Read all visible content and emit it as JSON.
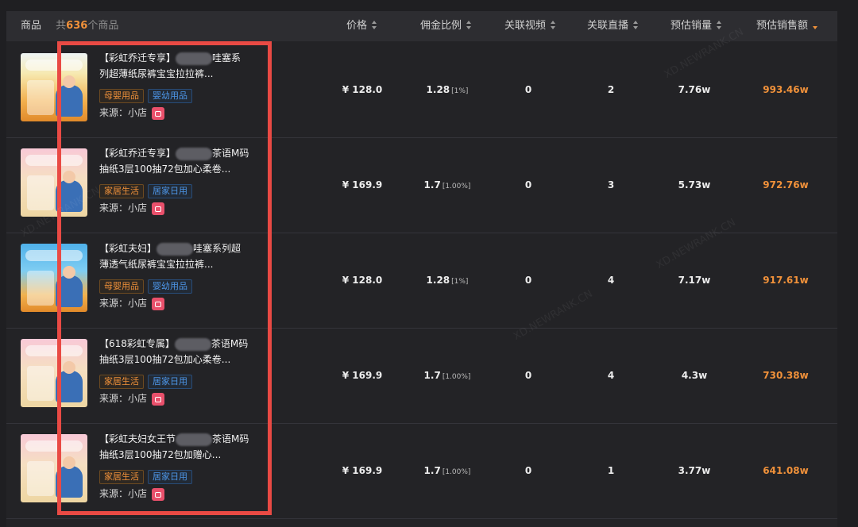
{
  "header": {
    "product_label": "商品",
    "total_prefix": "共",
    "total_count": "636",
    "total_suffix": "个商品",
    "columns": [
      "价格",
      "佣金比例",
      "关联视频",
      "关联直播",
      "预估销量",
      "预估销售额"
    ],
    "sorted_column": "预估销售额"
  },
  "rows": [
    {
      "title": "【彩虹乔迁专享】（已遮挡）哇塞系列超薄纸尿裤宝宝拉拉裤...",
      "title_a": "【彩虹乔迁专享】",
      "title_b": "哇塞系列超薄纸尿裤宝宝拉拉裤...",
      "tags": [
        "母婴用品",
        "婴幼用品"
      ],
      "source_label": "来源：小店",
      "price": "¥ 128.0",
      "commission": "1.28",
      "commission_pct": "[1%]",
      "videos": "0",
      "lives": "2",
      "est_sales": "7.76w",
      "est_revenue": "993.46w",
      "thumb": "diaper"
    },
    {
      "title": "【彩虹乔迁专享】（已遮挡）茶语M码抽纸3层100抽72包加心柔卷...",
      "title_a": "【彩虹乔迁专享】",
      "title_b": "茶语M码抽纸3层100抽72包加心柔卷...",
      "tags": [
        "家居生活",
        "居家日用"
      ],
      "source_label": "来源：小店",
      "price": "¥ 169.9",
      "commission": "1.7",
      "commission_pct": "[1.00%]",
      "videos": "0",
      "lives": "3",
      "est_sales": "5.73w",
      "est_revenue": "972.76w",
      "thumb": "tissue"
    },
    {
      "title": "【彩虹夫妇】（已遮挡）哇塞系列超薄透气纸尿裤宝宝拉拉裤...",
      "title_a": "【彩虹夫妇】",
      "title_b": "哇塞系列超薄透气纸尿裤宝宝拉拉裤...",
      "tags": [
        "母婴用品",
        "婴幼用品"
      ],
      "source_label": "来源：小店",
      "price": "¥ 128.0",
      "commission": "1.28",
      "commission_pct": "[1%]",
      "videos": "0",
      "lives": "4",
      "est_sales": "7.17w",
      "est_revenue": "917.61w",
      "thumb": "blue"
    },
    {
      "title": "【618彩虹专属】（已遮挡）茶语M码抽纸3层100抽72包加心柔卷...",
      "title_a": "【618彩虹专属】",
      "title_b": "茶语M码抽纸3层100抽72包加心柔卷...",
      "tags": [
        "家居生活",
        "居家日用"
      ],
      "source_label": "来源：小店",
      "price": "¥ 169.9",
      "commission": "1.7",
      "commission_pct": "[1.00%]",
      "videos": "0",
      "lives": "4",
      "est_sales": "4.3w",
      "est_revenue": "730.38w",
      "thumb": "tissue"
    },
    {
      "title": "【彩虹夫妇女王节（已遮挡）茶语M码抽纸3层100抽72包加赠心...",
      "title_a": "【彩虹夫妇女王节",
      "title_b": "茶语M码抽纸3层100抽72包加赠心...",
      "tags": [
        "家居生活",
        "居家日用"
      ],
      "source_label": "来源：小店",
      "price": "¥ 169.9",
      "commission": "1.7",
      "commission_pct": "[1.00%]",
      "videos": "0",
      "lives": "1",
      "est_sales": "3.77w",
      "est_revenue": "641.08w",
      "thumb": "tissue"
    }
  ],
  "watermark": "XD.NEWRANK.CN",
  "colors": {
    "accent": "#f0913a",
    "tag_blue": "#4d96e8",
    "highlight_border": "#e94a44",
    "background": "#1f1f22"
  }
}
